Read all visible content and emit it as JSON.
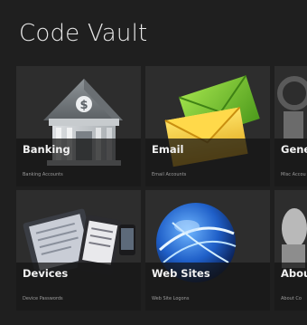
{
  "app": {
    "title": "Code Vault"
  },
  "tiles": [
    {
      "label": "Banking",
      "sublabel": "Banking Accounts",
      "icon": "bank-building-icon"
    },
    {
      "label": "Email",
      "sublabel": "Email Accounts",
      "icon": "envelopes-icon"
    },
    {
      "label": "Gene",
      "sublabel": "Misc Accou",
      "icon": "general-icon"
    },
    {
      "label": "Devices",
      "sublabel": "Device Passwords",
      "icon": "devices-icon"
    },
    {
      "label": "Web Sites",
      "sublabel": "Web Site Logons",
      "icon": "globe-icon"
    },
    {
      "label": "Abou",
      "sublabel": "About Co",
      "icon": "about-icon"
    }
  ]
}
